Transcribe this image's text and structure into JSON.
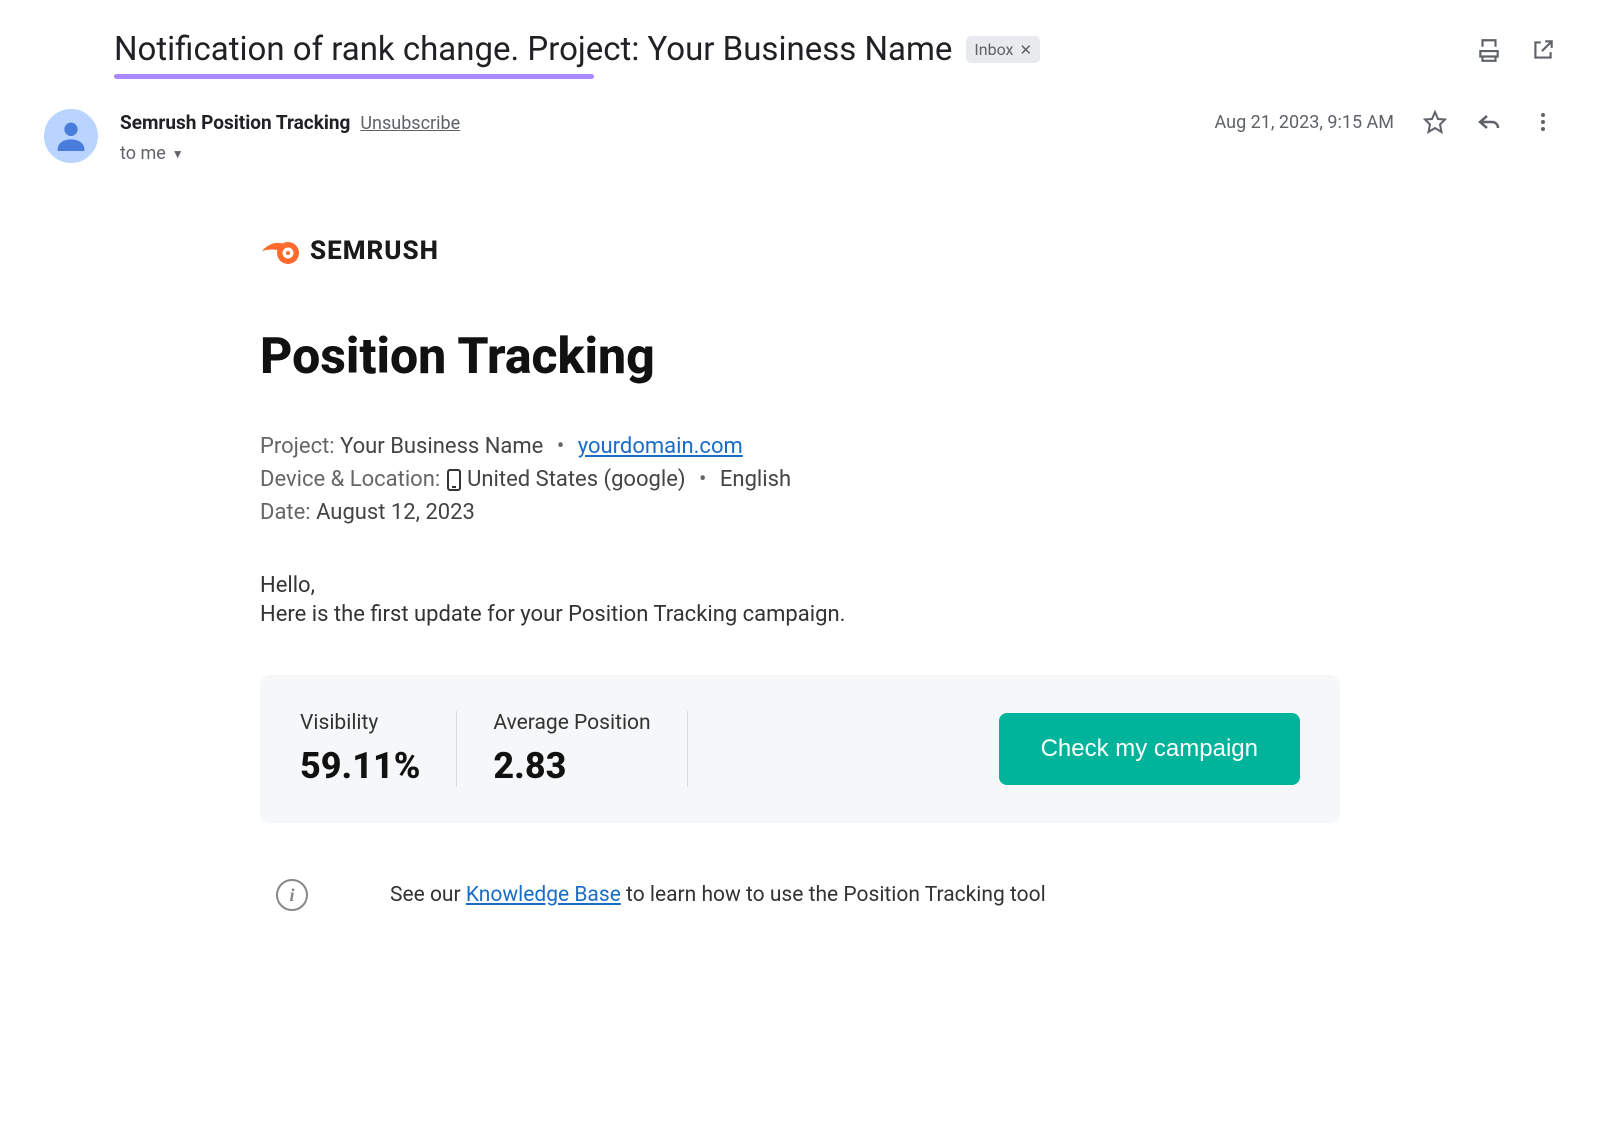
{
  "header": {
    "subject": "Notification of rank change. Project: Your Business Name",
    "inbox_label": "Inbox"
  },
  "sender": {
    "name": "Semrush Position Tracking",
    "unsubscribe": "Unsubscribe",
    "timestamp": "Aug 21, 2023, 9:15 AM",
    "to_label": "to me"
  },
  "brand": {
    "name": "SEMRUSH"
  },
  "content": {
    "title": "Position Tracking",
    "project_label": "Project:",
    "project_name": "Your Business Name",
    "domain": "yourdomain.com",
    "device_label": "Device & Location:",
    "device_location": "United States (google)",
    "language": "English",
    "date_label": "Date:",
    "date_value": "August 12, 2023",
    "greeting_1": "Hello,",
    "greeting_2": "Here is the first update for your Position Tracking campaign."
  },
  "stats": {
    "visibility_label": "Visibility",
    "visibility_value": "59.11%",
    "avg_pos_label": "Average Position",
    "avg_pos_value": "2.83",
    "cta": "Check my campaign"
  },
  "footer": {
    "kb_pre": "See our ",
    "kb_link": "Knowledge Base",
    "kb_post": " to learn how to use the Position Tracking tool"
  }
}
